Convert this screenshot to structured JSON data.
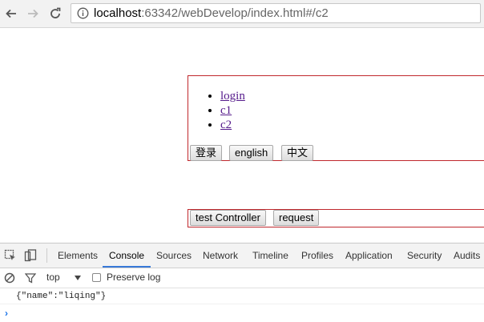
{
  "browser": {
    "url_host": "localhost",
    "url_rest": ":63342/webDevelop/index.html#/c2",
    "icons": {
      "back": "arrow-left-icon",
      "forward": "arrow-right-icon",
      "reload": "reload-icon",
      "site_info": "info-icon"
    }
  },
  "page": {
    "nav_links": [
      "login",
      "c1",
      "c2"
    ],
    "buttons": {
      "login": "登录",
      "english": "english",
      "chinese": "中文",
      "test_controller": "test Controller",
      "request": "request"
    }
  },
  "devtools": {
    "tabs": [
      "Elements",
      "Console",
      "Sources",
      "Network",
      "Timeline",
      "Profiles",
      "Application",
      "Security",
      "Audits"
    ],
    "active_tab": "Console",
    "context": "top",
    "preserve_log": "Preserve log",
    "console_output": "{\"name\":\"liqing\"}",
    "prompt": "›"
  }
}
